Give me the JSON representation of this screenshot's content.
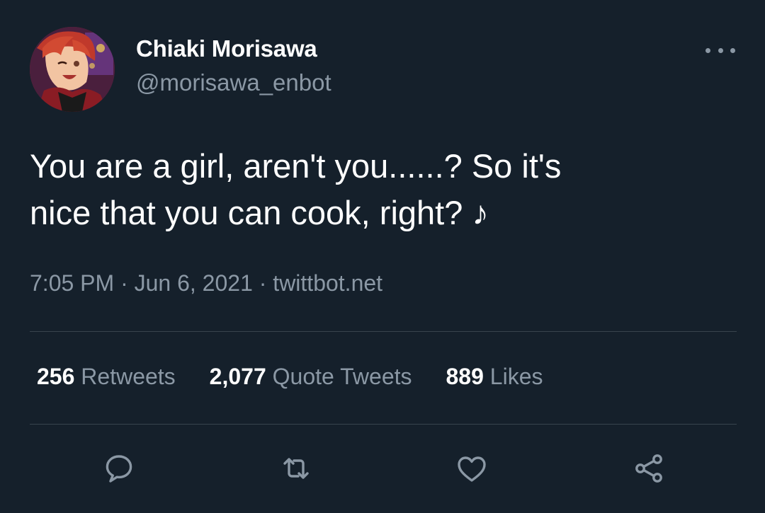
{
  "author": {
    "display_name": "Chiaki Morisawa",
    "handle": "@morisawa_enbot",
    "avatar_icon": "profile-avatar"
  },
  "tweet": {
    "text": "You are a girl, aren't you......? So it's\nnice that you can cook, right? ♪",
    "time": "7:05 PM",
    "separator": "·",
    "date": "Jun 6, 2021",
    "source": "twittbot.net"
  },
  "stats": {
    "retweets_count": "256",
    "retweets_label": "Retweets",
    "quotes_count": "2,077",
    "quotes_label": "Quote Tweets",
    "likes_count": "889",
    "likes_label": "Likes"
  },
  "actions": {
    "reply_icon": "reply-icon",
    "retweet_icon": "retweet-icon",
    "like_icon": "heart-icon",
    "share_icon": "share-icon"
  },
  "colors": {
    "background": "#15202b",
    "primary_text": "#ffffff",
    "secondary_text": "#8b98a5",
    "divider": "#38444d"
  }
}
